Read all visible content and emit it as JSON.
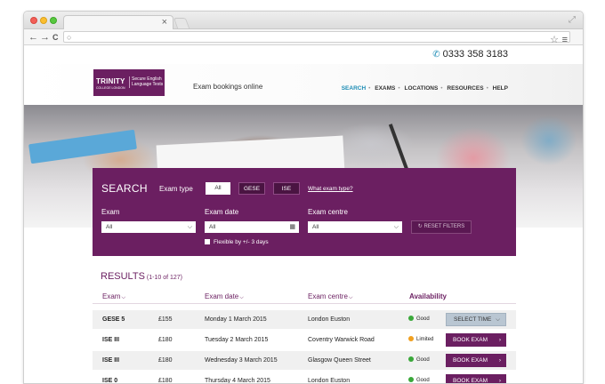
{
  "browser": {
    "tab_close": "×",
    "nav_back": "←",
    "nav_forward": "→",
    "nav_reload": "C"
  },
  "site": {
    "phone": "0333 358 3183",
    "logo": {
      "main": "TRINITY",
      "sub": "Secure English Language Tests",
      "tiny": "COLLEGE LONDON"
    },
    "tagline": "Exam bookings online",
    "nav": [
      "SEARCH",
      "EXAMS",
      "LOCATIONS",
      "RESOURCES",
      "HELP"
    ],
    "nav_active_color": "#1d8db6"
  },
  "search": {
    "title": "SEARCH",
    "exam_type_label": "Exam type",
    "types": [
      "All",
      "GESE",
      "ISE"
    ],
    "what_link": "What exam type?",
    "exam_label": "Exam",
    "exam_value": "All",
    "date_label": "Exam date",
    "date_value": "All",
    "centre_label": "Exam centre",
    "centre_value": "All",
    "flexible_label": "Flexible by +/- 3 days",
    "reset_label": "RESET FILTERS"
  },
  "results": {
    "title": "RESULTS",
    "count": "(1-10 of 127)",
    "headers": {
      "exam": "Exam",
      "date": "Exam date",
      "centre": "Exam centre",
      "availability": "Availability"
    },
    "rows": [
      {
        "exam": "GESE 5",
        "price": "£155",
        "date": "Monday 1 March 2015",
        "centre": "London Euston",
        "availability": "Good",
        "status_color": "#3aa83a",
        "action": "SELECT TIME"
      },
      {
        "exam": "ISE III",
        "price": "£180",
        "date": "Tuesday 2 March 2015",
        "centre": "Coventry Warwick Road",
        "availability": "Limited",
        "status_color": "#f0a020",
        "action": "BOOK EXAM"
      },
      {
        "exam": "ISE III",
        "price": "£180",
        "date": "Wednesday 3 March 2015",
        "centre": "Glasgow Queen Street",
        "availability": "Good",
        "status_color": "#3aa83a",
        "action": "BOOK EXAM"
      },
      {
        "exam": "ISE 0",
        "price": "£180",
        "date": "Thursday 4 March 2015",
        "centre": "London Euston",
        "availability": "Good",
        "status_color": "#3aa83a",
        "action": "BOOK EXAM"
      }
    ]
  },
  "colors": {
    "brand": "#6b1f61",
    "good": "#3aa83a",
    "limited": "#f0a020"
  }
}
